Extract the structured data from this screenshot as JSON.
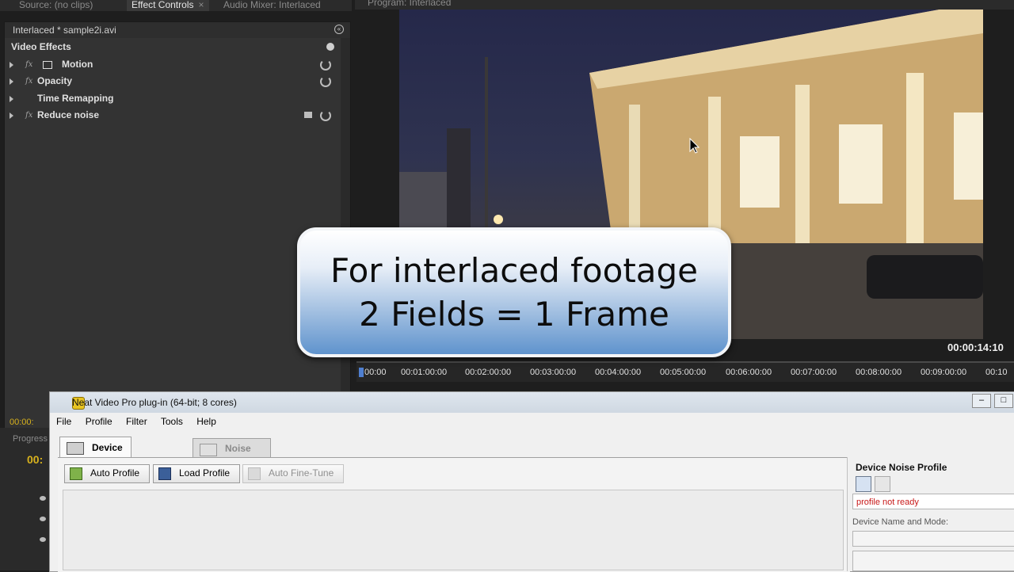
{
  "premiere": {
    "tabs": {
      "source": "Source: (no clips)",
      "effect_controls": "Effect Controls",
      "audio_mixer": "Audio Mixer: Interlaced",
      "program": "Program: Interlaced"
    },
    "effect_controls": {
      "clip_header": "Interlaced * sample2i.avi",
      "section_title": "Video Effects",
      "fx_symbol": "fx",
      "effects": [
        "Motion",
        "Opacity",
        "Time Remapping",
        "Reduce noise"
      ]
    },
    "program_monitor": {
      "timecode": "00:00:14:10",
      "ruler_labels": [
        "00:00",
        "00:01:00:00",
        "00:02:00:00",
        "00:03:00:00",
        "00:04:00:00",
        "00:05:00:00",
        "00:06:00:00",
        "00:07:00:00",
        "00:08:00:00",
        "00:09:00:00",
        "00:10"
      ]
    },
    "left_strip": {
      "timecode_small": "00:00:",
      "progress_label": "Progress",
      "timecode_large": "00:"
    }
  },
  "callout": {
    "line1": "For interlaced footage",
    "line2": "2 Fields = 1 Frame"
  },
  "neat_video": {
    "window_title": "Neat Video Pro plug-in (64-bit; 8 cores)",
    "menu": [
      "File",
      "Profile",
      "Filter",
      "Tools",
      "Help"
    ],
    "tabs": [
      "Device Noise Profile",
      "Noise Filter Settings"
    ],
    "toolbar": {
      "auto_profile": "Auto Profile",
      "load_profile": "Load Profile",
      "auto_fine_tune": "Auto Fine-Tune"
    },
    "right_panel": {
      "title": "Device Noise Profile",
      "status": "profile not ready",
      "device_label": "Device Name and Mode:"
    }
  }
}
